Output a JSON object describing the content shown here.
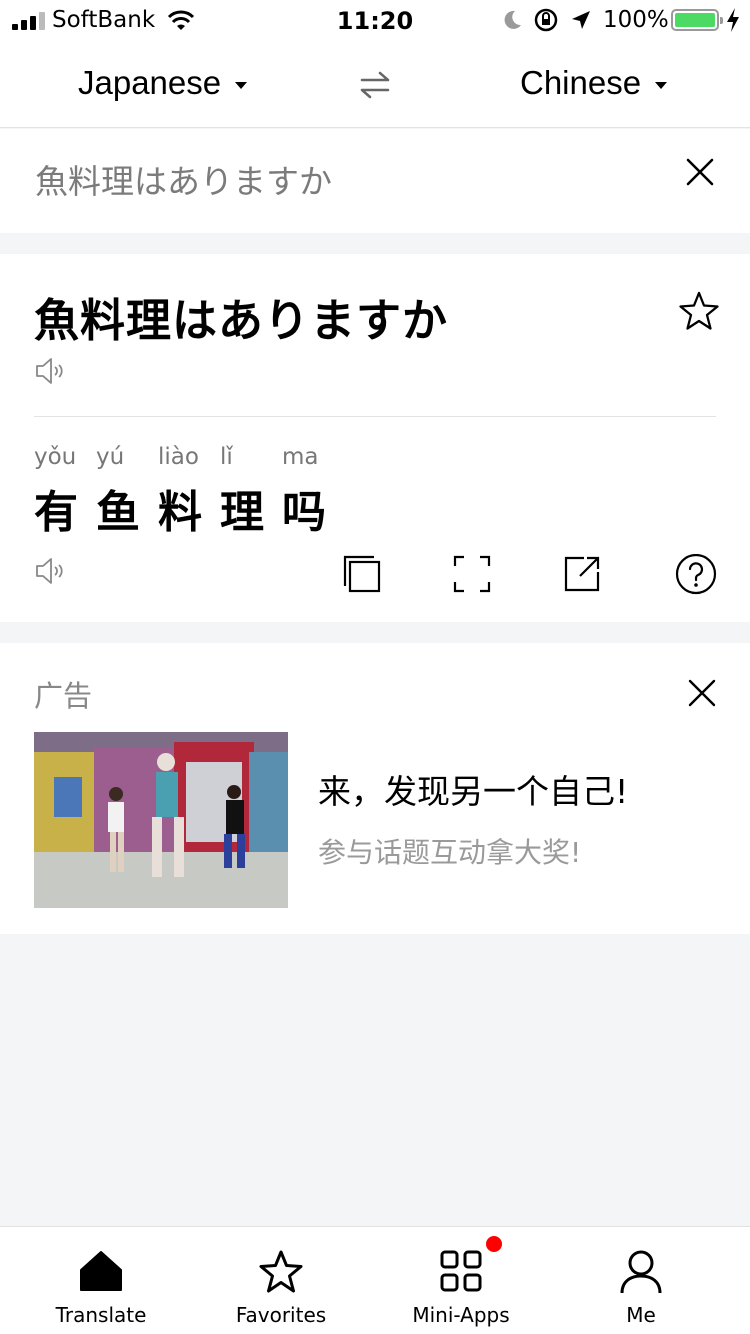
{
  "status_bar": {
    "carrier": "SoftBank",
    "time": "11:20",
    "battery_percent": "100%",
    "battery_level": 1.0,
    "signal_bars": 3
  },
  "language_bar": {
    "source_language": "Japanese",
    "target_language": "Chinese"
  },
  "input": {
    "text": "魚料理はありますか"
  },
  "result": {
    "source_text": "魚料理はありますか",
    "tokens": [
      {
        "pinyin": "yǒu",
        "char": "有"
      },
      {
        "pinyin": "yú",
        "char": "鱼"
      },
      {
        "pinyin": "liào",
        "char": "料"
      },
      {
        "pinyin": "lǐ",
        "char": "理"
      },
      {
        "pinyin": "ma",
        "char": "吗"
      }
    ]
  },
  "ad": {
    "label": "广告",
    "title": "来，发现另一个自己!",
    "subtitle": "参与话题互动拿大奖!"
  },
  "tab_bar": {
    "tabs": [
      {
        "label": "Translate",
        "icon": "home-icon"
      },
      {
        "label": "Favorites",
        "icon": "star-icon"
      },
      {
        "label": "Mini-Apps",
        "icon": "grid-icon",
        "badge": true
      },
      {
        "label": "Me",
        "icon": "person-icon"
      }
    ]
  },
  "colors": {
    "battery_fill": "#4cd964",
    "badge": "#ff0000",
    "page_background": "#f4f5f7"
  }
}
